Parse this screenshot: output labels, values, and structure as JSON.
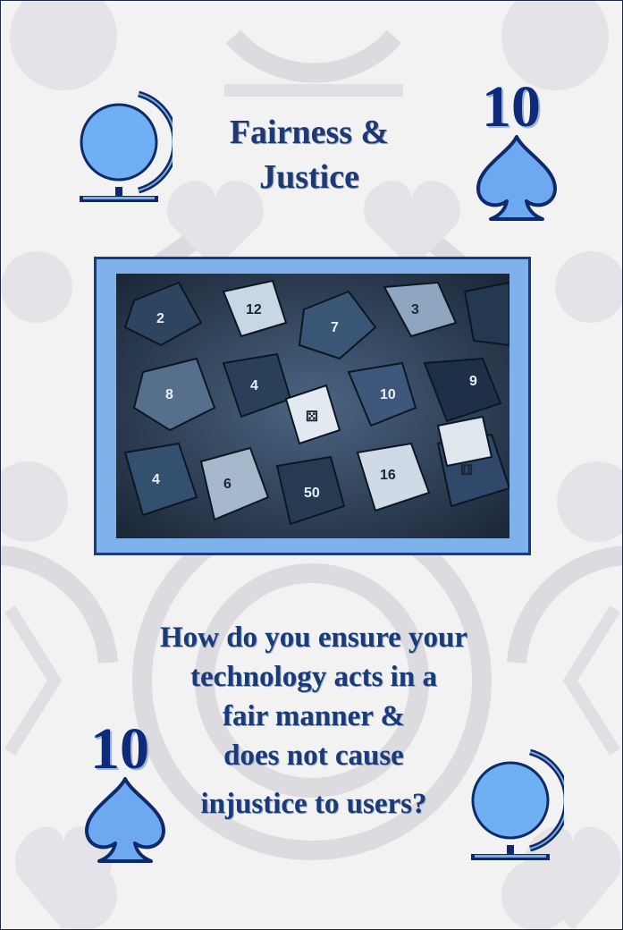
{
  "card": {
    "title_lines": [
      "Fairness &",
      "Justice"
    ],
    "rank": "10",
    "suit_icon": "spade-icon",
    "corner_icon": "globe-icon",
    "question_lines": [
      "How do you ensure your",
      "technology acts in a",
      "fair manner &",
      "does not cause",
      "injustice to users?"
    ],
    "image_subject": "dice-photo",
    "colors": {
      "title": "#1f3a72",
      "rank": "#0e2a7a",
      "suit_fill": "#6ea8f0",
      "frame": "#7fb1ea",
      "border": "#1a3a86"
    }
  }
}
